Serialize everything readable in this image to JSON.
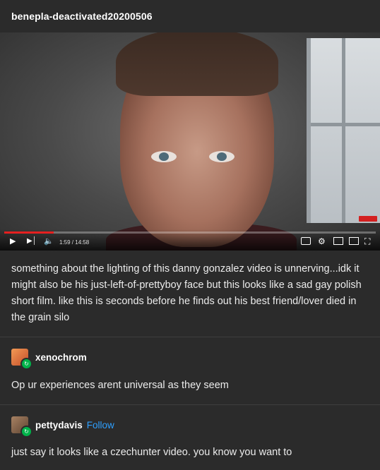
{
  "post": {
    "blog_name": "benepla-deactivated20200506",
    "caption": "something about the lighting of this danny gonzalez video is unnerving...idk it might also be his just-left-of-prettyboy face but this looks like a sad gay polish short film. like this is seconds before he finds out his best friend/lover died in the grain silo"
  },
  "video": {
    "time_display": "1:59 / 14:58",
    "progress": 0.133,
    "play_icon": "play-icon",
    "next_icon": "next-icon",
    "volume_icon": "volume-icon",
    "controls_right": [
      "cc-icon",
      "settings-icon",
      "miniplayer-icon",
      "theater-icon",
      "fullscreen-icon"
    ],
    "accent": "#e52020"
  },
  "replies": [
    {
      "username": "xenochrom",
      "text": "Op ur experiences arent universal as they seem",
      "avatar_color": "#d9683a"
    },
    {
      "username": "pettydavis",
      "follow_label": "Follow",
      "text": "just say it looks like a czechunter video. you know you want to",
      "avatar_color": "#8a6a4f"
    }
  ]
}
